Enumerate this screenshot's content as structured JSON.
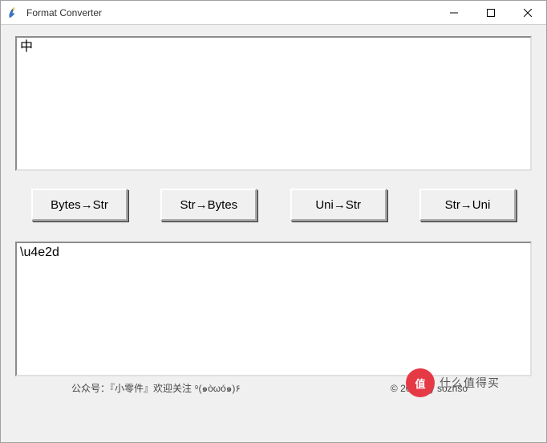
{
  "window": {
    "title": "Format Converter"
  },
  "input_top": {
    "value": "中"
  },
  "buttons": {
    "bytes_to_str": "Bytes→Str",
    "str_to_bytes": "Str→Bytes",
    "uni_to_str": "Uni→Str",
    "str_to_uni": "Str→Uni"
  },
  "input_bottom": {
    "value": "\\u4e2d"
  },
  "footer": {
    "left": "公众号：『小零件』欢迎关注 ⁹(๑òωó๑)۶",
    "copyright": "© 20▮▮ by soznso"
  },
  "watermark": {
    "circle": "值",
    "text": "什么值得买"
  }
}
